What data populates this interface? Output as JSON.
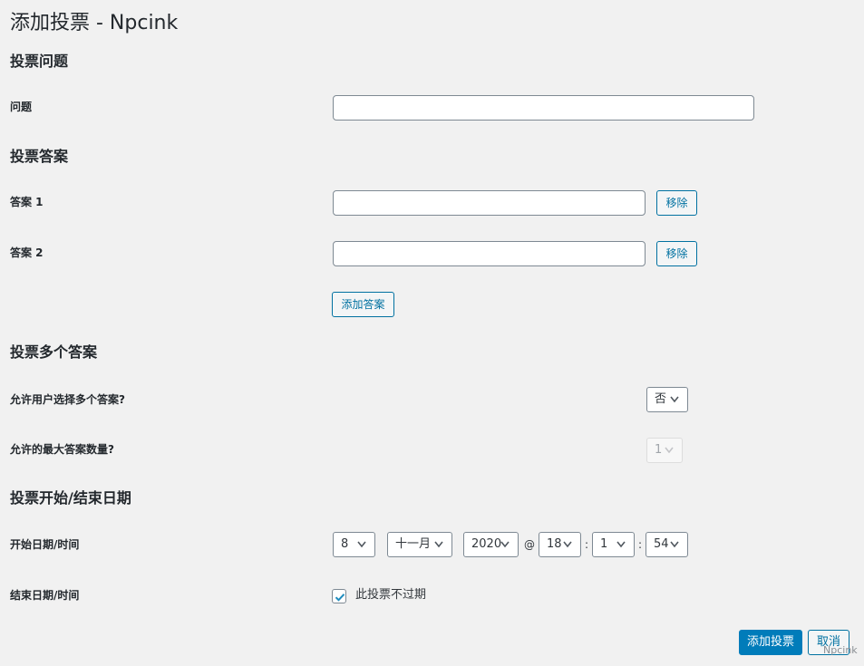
{
  "page": {
    "title": "添加投票 - Npcink"
  },
  "question_section": {
    "title": "投票问题",
    "question_label": "问题",
    "question_value": ""
  },
  "answers_section": {
    "title": "投票答案",
    "answers": [
      {
        "label": "答案 1",
        "value": "",
        "remove_label": "移除"
      },
      {
        "label": "答案 2",
        "value": "",
        "remove_label": "移除"
      }
    ],
    "add_answer_label": "添加答案"
  },
  "multiple_section": {
    "title": "投票多个答案",
    "allow_multiple_label": "允许用户选择多个答案?",
    "allow_multiple_value": "否",
    "max_answers_label": "允许的最大答案数量?",
    "max_answers_value": "1"
  },
  "date_section": {
    "title": "投票开始/结束日期",
    "start_label": "开始日期/时间",
    "start": {
      "day": "8",
      "month": "十一月",
      "year": "2020",
      "at": "@",
      "hour": "18",
      "minute": "1",
      "second": "54",
      "colon": ":"
    },
    "end_label": "结束日期/时间",
    "never_expire_label": "此投票不过期",
    "never_expire_checked": true
  },
  "actions": {
    "submit_label": "添加投票",
    "cancel_label": "取消"
  },
  "watermark": "Npcink",
  "colors": {
    "accent": "#007cba",
    "link": "#0071a1",
    "background": "#f1f1f1"
  },
  "icons": {
    "select_arrow": "chevron-down-icon",
    "checkbox_check": "checkmark-icon"
  }
}
